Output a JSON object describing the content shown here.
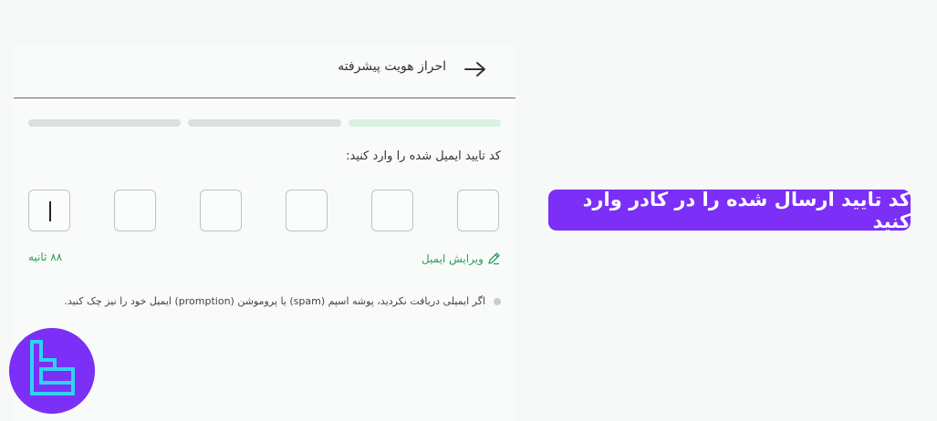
{
  "header": {
    "title": "احراز هویت پیشرفته",
    "back_icon": "arrow-right-icon"
  },
  "progress": {
    "steps_total": 3,
    "current_step": 1,
    "active_color": "#d7f2df",
    "inactive_color": "#dcdfde"
  },
  "verification": {
    "instruction": "کد تایید ایمیل شده را وارد کنید:",
    "code_length": 6,
    "edit_email_label": "ویرایش ایمیل",
    "edit_icon": "pencil-icon",
    "timer_text": "۸۸ ثانیه",
    "note": "اگر ایمیلی دریافت نکردید، پوشه اسپم (spam) یا پروموشن (promption) ایمیل خود را نیز چک کنید."
  },
  "callout": {
    "text": "کد تایید ارسال شده را در کادر وارد کنید",
    "color": "#7b2ff7"
  },
  "logo": {
    "icon": "brand-logo-icon",
    "color": "#7b2ff7",
    "accent": "#2ed3f2"
  },
  "colors": {
    "accent_green": "#2c9c5a"
  }
}
